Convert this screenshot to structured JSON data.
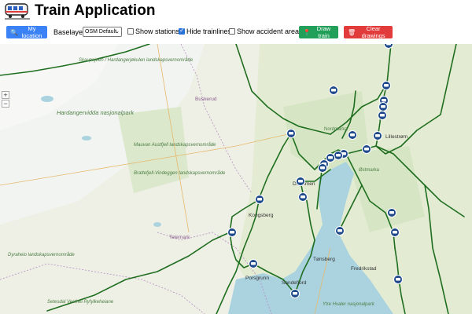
{
  "header": {
    "title": "Train Application",
    "logo_icon": "train-icon"
  },
  "toolbar": {
    "location_button": "My location",
    "baselayer_label": "Baselayer:",
    "baselayer_value": "OSM Default",
    "show_stations": "Show stations",
    "show_stations_checked": false,
    "hide_trainlines": "Hide trainlines",
    "hide_trainlines_checked": true,
    "show_accident_areas": "Show accident areas",
    "show_accident_areas_checked": false,
    "draw_button": "Draw train",
    "clear_button": "Clear drawings"
  },
  "map": {
    "zoom_in": "+",
    "zoom_out": "−",
    "labels": [
      "Skaupsjøen / Hardangerjøkulen landskapsvernområde",
      "Hardangervidda nasjonalpark",
      "Buskerud",
      "Nordmarka",
      "Østmarka",
      "Telemark",
      "Porsgrunn",
      "Tønsberg",
      "Sandefjord",
      "Fredrikstad",
      "Lillestrøm",
      "Drammen",
      "Kongsberg",
      "Ytre Hvaler nasjonalpark",
      "Setesdal Vesthei Ryfylkeheiane",
      "Dyraheio landskapsvernområde",
      "Brattefjell-Vindeggen landskapsvernområde",
      "Mauvan Austfjell landskapsvernområde"
    ]
  },
  "colors": {
    "rail": "#1f6e1f",
    "water": "#aad3df",
    "marker": "#1e4a8c"
  }
}
